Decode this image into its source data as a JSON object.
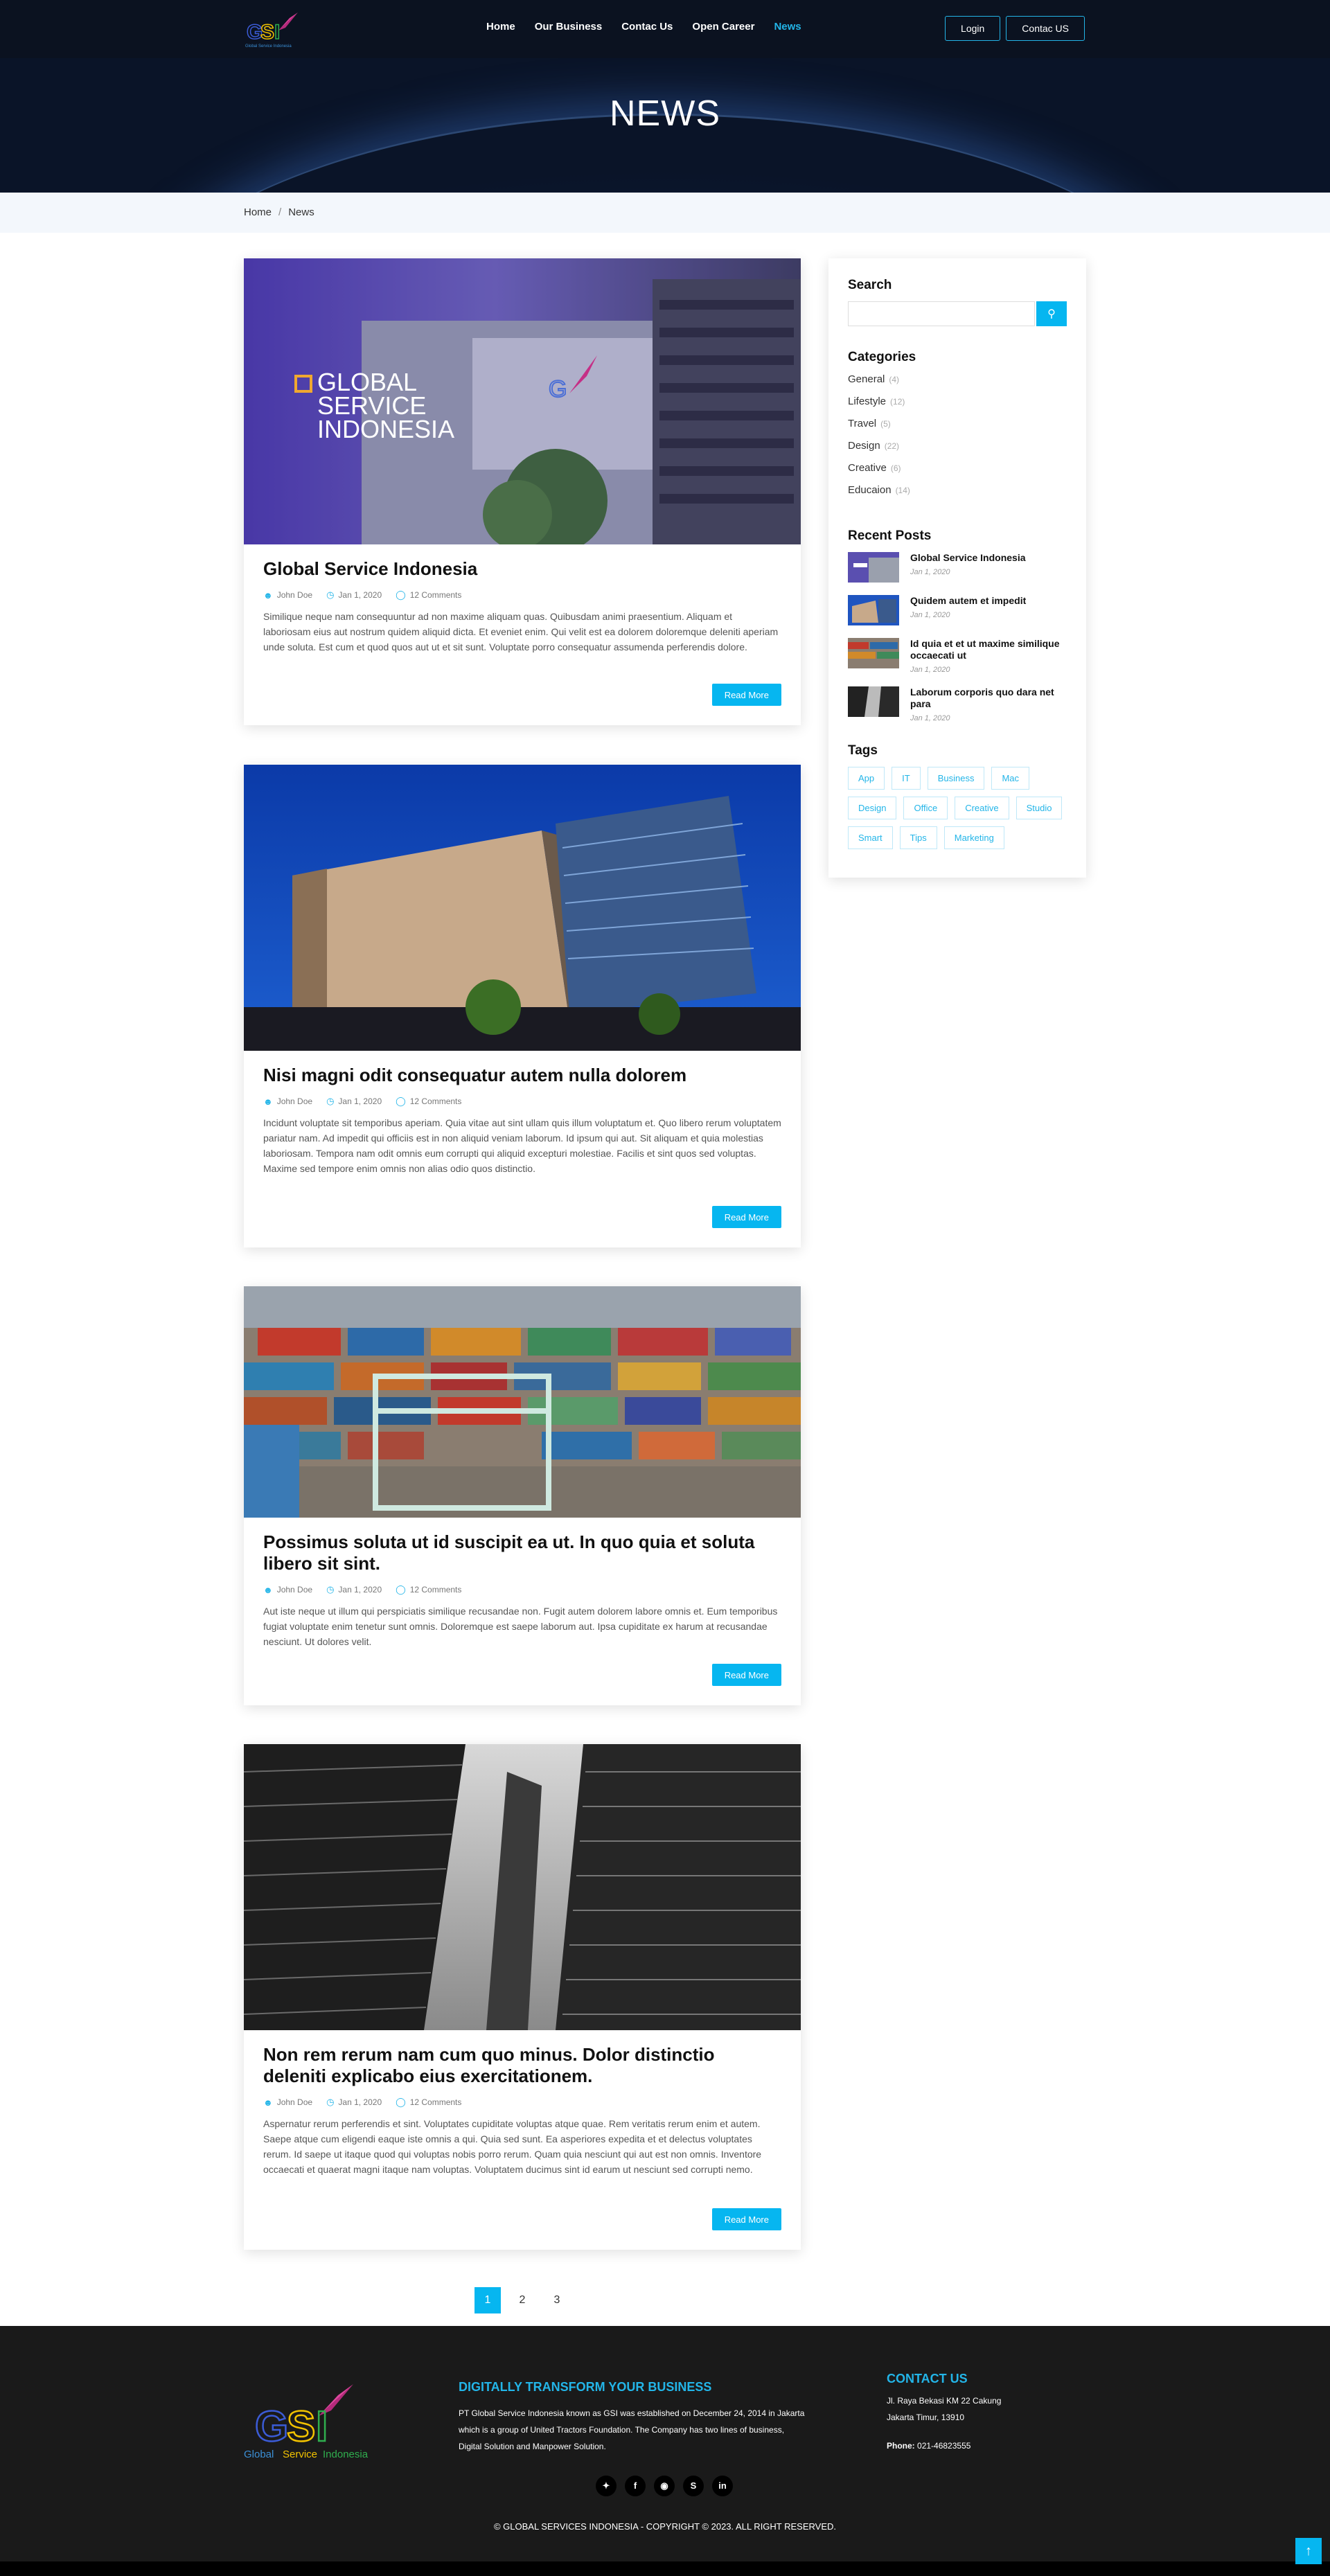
{
  "header": {
    "nav": [
      "Home",
      "Our Business",
      "Contac Us",
      "Open Career",
      "News"
    ],
    "active_nav": "News",
    "login_label": "Login",
    "contact_label": "Contac US"
  },
  "hero": {
    "title": "NEWS"
  },
  "breadcrumb": {
    "home": "Home",
    "separator": "/",
    "current": "News"
  },
  "posts": [
    {
      "title": "Global Service Indonesia",
      "image_overlay_text": [
        "GLOBAL",
        "SERVICE",
        "INDONESIA"
      ],
      "author": "John Doe",
      "date": "Jan 1, 2020",
      "comments": "12 Comments",
      "excerpt": "Similique neque nam consequuntur ad non maxime aliquam quas. Quibusdam animi praesentium. Aliquam et laboriosam eius aut nostrum quidem aliquid dicta. Et eveniet enim. Qui velit est ea dolorem doloremque deleniti aperiam unde soluta. Est cum et quod quos aut ut et sit sunt. Voluptate porro consequatur assumenda perferendis dolore.",
      "read_more": "Read More"
    },
    {
      "title": "Nisi magni odit consequatur autem nulla dolorem",
      "author": "John Doe",
      "date": "Jan 1, 2020",
      "comments": "12 Comments",
      "excerpt": "Incidunt voluptate sit temporibus aperiam. Quia vitae aut sint ullam quis illum voluptatum et. Quo libero rerum voluptatem pariatur nam. Ad impedit qui officiis est in non aliquid veniam laborum. Id ipsum qui aut. Sit aliquam et quia molestias laboriosam. Tempora nam odit omnis eum corrupti qui aliquid excepturi molestiae. Facilis et sint quos sed voluptas. Maxime sed tempore enim omnis non alias odio quos distinctio.",
      "read_more": "Read More"
    },
    {
      "title": "Possimus soluta ut id suscipit ea ut. In quo quia et soluta libero sit sint.",
      "author": "John Doe",
      "date": "Jan 1, 2020",
      "comments": "12 Comments",
      "excerpt": "Aut iste neque ut illum qui perspiciatis similique recusandae non. Fugit autem dolorem labore omnis et. Eum temporibus fugiat voluptate enim tenetur sunt omnis. Doloremque est saepe laborum aut. Ipsa cupiditate ex harum at recusandae nesciunt. Ut dolores velit.",
      "read_more": "Read More"
    },
    {
      "title": "Non rem rerum nam cum quo minus. Dolor distinctio deleniti explicabo eius exercitationem.",
      "author": "John Doe",
      "date": "Jan 1, 2020",
      "comments": "12 Comments",
      "excerpt": "Aspernatur rerum perferendis et sint. Voluptates cupiditate voluptas atque quae. Rem veritatis rerum enim et autem. Saepe atque cum eligendi eaque iste omnis a qui. Quia sed sunt. Ea asperiores expedita et et delectus voluptates rerum. Id saepe ut itaque quod qui voluptas nobis porro rerum. Quam quia nesciunt qui aut est non omnis. Inventore occaecati et quaerat magni itaque nam voluptas. Voluptatem ducimus sint id earum ut nesciunt sed corrupti nemo.",
      "read_more": "Read More"
    }
  ],
  "sidebar": {
    "search_title": "Search",
    "search_placeholder": "",
    "categories_title": "Categories",
    "categories": [
      {
        "name": "General",
        "count": "(4)"
      },
      {
        "name": "Lifestyle",
        "count": "(12)"
      },
      {
        "name": "Travel",
        "count": "(5)"
      },
      {
        "name": "Design",
        "count": "(22)"
      },
      {
        "name": "Creative",
        "count": "(6)"
      },
      {
        "name": "Educaion",
        "count": "(14)"
      }
    ],
    "recent_title": "Recent Posts",
    "recent": [
      {
        "title": "Global Service Indonesia",
        "date": "Jan 1, 2020"
      },
      {
        "title": "Quidem autem et impedit",
        "date": "Jan 1, 2020"
      },
      {
        "title": "Id quia et et ut maxime similique occaecati ut",
        "date": "Jan 1, 2020"
      },
      {
        "title": "Laborum corporis quo dara net para",
        "date": "Jan 1, 2020"
      }
    ],
    "tags_title": "Tags",
    "tags": [
      "App",
      "IT",
      "Business",
      "Mac",
      "Design",
      "Office",
      "Creative",
      "Studio",
      "Smart",
      "Tips",
      "Marketing"
    ]
  },
  "pagination": [
    "1",
    "2",
    "3"
  ],
  "footer": {
    "logo_text": [
      "Global",
      "Service",
      "Indonesia"
    ],
    "headline": "DIGITALLY TRANSFORM YOUR BUSINESS",
    "description": "PT Global Service Indonesia known as GSI was established on December 24, 2014 in Jakarta which is a group of United Tractors Foundation. The Company has two lines of business, Digital Solution and Manpower Solution.",
    "contact_title": "CONTACT US",
    "address_line1": "Jl. Raya Bekasi KM 22 Cakung",
    "address_line2": "Jakarta Timur, 13910",
    "phone_label": "Phone:",
    "phone": "021-46823555",
    "copyright": "© GLOBAL SERVICES INDONESIA - COPYRIGHT © 2023. ALL RIGHT RESERVED."
  },
  "colors": {
    "accent": "#06b6f0",
    "header_bg": "#0b1220",
    "footer_bg": "#1a1a1a"
  },
  "icons": [
    "user-icon",
    "clock-icon",
    "comment-icon",
    "search-icon",
    "twitter-icon",
    "facebook-icon",
    "instagram-icon",
    "skype-icon",
    "linkedin-icon",
    "arrow-up-icon"
  ]
}
